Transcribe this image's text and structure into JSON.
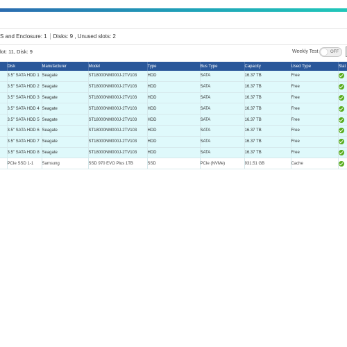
{
  "summary": {
    "enclosure_text": "S and Enclosure: 1",
    "disks_text": "Disks: 9 , Unused slots: 2"
  },
  "slot_info": "lot: 11, Disk: 9",
  "weekly_test": {
    "label": "Weekly Test",
    "state": "OFF"
  },
  "table": {
    "columns": [
      "Disk",
      "Manufacturer",
      "Model",
      "Type",
      "Bus Type",
      "Capacity",
      "Used Type",
      "Stat"
    ],
    "rows": [
      {
        "disk": "3.5\" SATA HDD 1",
        "manufacturer": "Seagate",
        "model": "ST18000NM000J-2TV103",
        "type": "HDD",
        "bus": "SATA",
        "capacity": "16.37 TB",
        "used": "Free",
        "status": "ok"
      },
      {
        "disk": "3.5\" SATA HDD 2",
        "manufacturer": "Seagate",
        "model": "ST18000NM000J-2TV103",
        "type": "HDD",
        "bus": "SATA",
        "capacity": "16.37 TB",
        "used": "Free",
        "status": "ok"
      },
      {
        "disk": "3.5\" SATA HDD 3",
        "manufacturer": "Seagate",
        "model": "ST18000NM000J-2TV103",
        "type": "HDD",
        "bus": "SATA",
        "capacity": "16.37 TB",
        "used": "Free",
        "status": "ok"
      },
      {
        "disk": "3.5\" SATA HDD 4",
        "manufacturer": "Seagate",
        "model": "ST18000NM000J-2TV103",
        "type": "HDD",
        "bus": "SATA",
        "capacity": "16.37 TB",
        "used": "Free",
        "status": "ok"
      },
      {
        "disk": "3.5\" SATA HDD 5",
        "manufacturer": "Seagate",
        "model": "ST18000NM000J-2TV103",
        "type": "HDD",
        "bus": "SATA",
        "capacity": "16.37 TB",
        "used": "Free",
        "status": "ok"
      },
      {
        "disk": "3.5\" SATA HDD 6",
        "manufacturer": "Seagate",
        "model": "ST18000NM000J-2TV103",
        "type": "HDD",
        "bus": "SATA",
        "capacity": "16.37 TB",
        "used": "Free",
        "status": "ok"
      },
      {
        "disk": "3.5\" SATA HDD 7",
        "manufacturer": "Seagate",
        "model": "ST18000NM000J-2TV103",
        "type": "HDD",
        "bus": "SATA",
        "capacity": "16.37 TB",
        "used": "Free",
        "status": "ok"
      },
      {
        "disk": "3.5\" SATA HDD 8",
        "manufacturer": "Seagate",
        "model": "ST18000NM000J-2TV103",
        "type": "HDD",
        "bus": "SATA",
        "capacity": "16.37 TB",
        "used": "Free",
        "status": "ok"
      },
      {
        "disk": "PCIe SSD 1-1",
        "manufacturer": "Samsung",
        "model": "SSD 970 EVO Plus 1TB",
        "type": "SSD",
        "bus": "PCIe (NVMe)",
        "capacity": "931.51 GB",
        "used": "Cache",
        "status": "ok"
      }
    ]
  },
  "colors": {
    "accent_start": "#2b6cb0",
    "accent_end": "#21c7b9",
    "header_bg": "#2a579a",
    "row_highlight": "#dff9fb",
    "status_ok": "#5aac1e"
  }
}
